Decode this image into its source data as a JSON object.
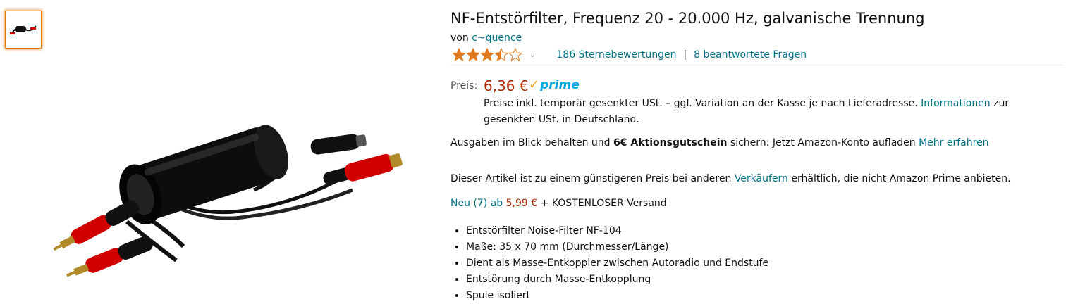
{
  "product": {
    "title": "NF-Entstörfilter, Frequenz 20 - 20.000 Hz, galvanische Trennung",
    "by_prefix": "von",
    "brand": "c~quence"
  },
  "rating": {
    "stars": 3.5,
    "count_text": "186 Sternebewertungen",
    "separator": "|",
    "answered_text": "8 beantwortete Fragen"
  },
  "price": {
    "label": "Preis:",
    "value": "6,36 €",
    "prime_check": "✓",
    "prime_label": "prime"
  },
  "vat": {
    "text_before": "Preise inkl. temporär gesenkter USt. – ggf. Variation an der Kasse je nach Lieferadresse.",
    "link": "Informationen",
    "text_after": "zur gesenkten USt. in Deutschland."
  },
  "coupon": {
    "text_before": "Ausgaben im Blick behalten und",
    "bold": "6€ Aktionsgutschein",
    "text_after": "sichern: Jetzt Amazon-Konto aufladen",
    "link": "Mehr erfahren"
  },
  "other_sellers": {
    "text_before": "Dieser Artikel ist zu einem günstigeren Preis bei anderen",
    "link": "Verkäufern",
    "text_after": "erhältlich, die nicht Amazon Prime anbieten."
  },
  "new_offers": {
    "link": "Neu (7) ab",
    "price": "5,99 €",
    "text": "+ KOSTENLOSER Versand"
  },
  "bullets": [
    "Entstörfilter Noise-Filter NF-104",
    "Maße: 35 x 70 mm (Durchmesser/Länge)",
    "Dient als Masse-Entkoppler zwischen Autoradio und Endstufe",
    "Entstörung durch Masse-Entkopplung",
    "Spule isoliert"
  ],
  "colors": {
    "link": "#007185",
    "price": "#B12704",
    "star": "#DE7921",
    "prime": "#00A8E1"
  }
}
